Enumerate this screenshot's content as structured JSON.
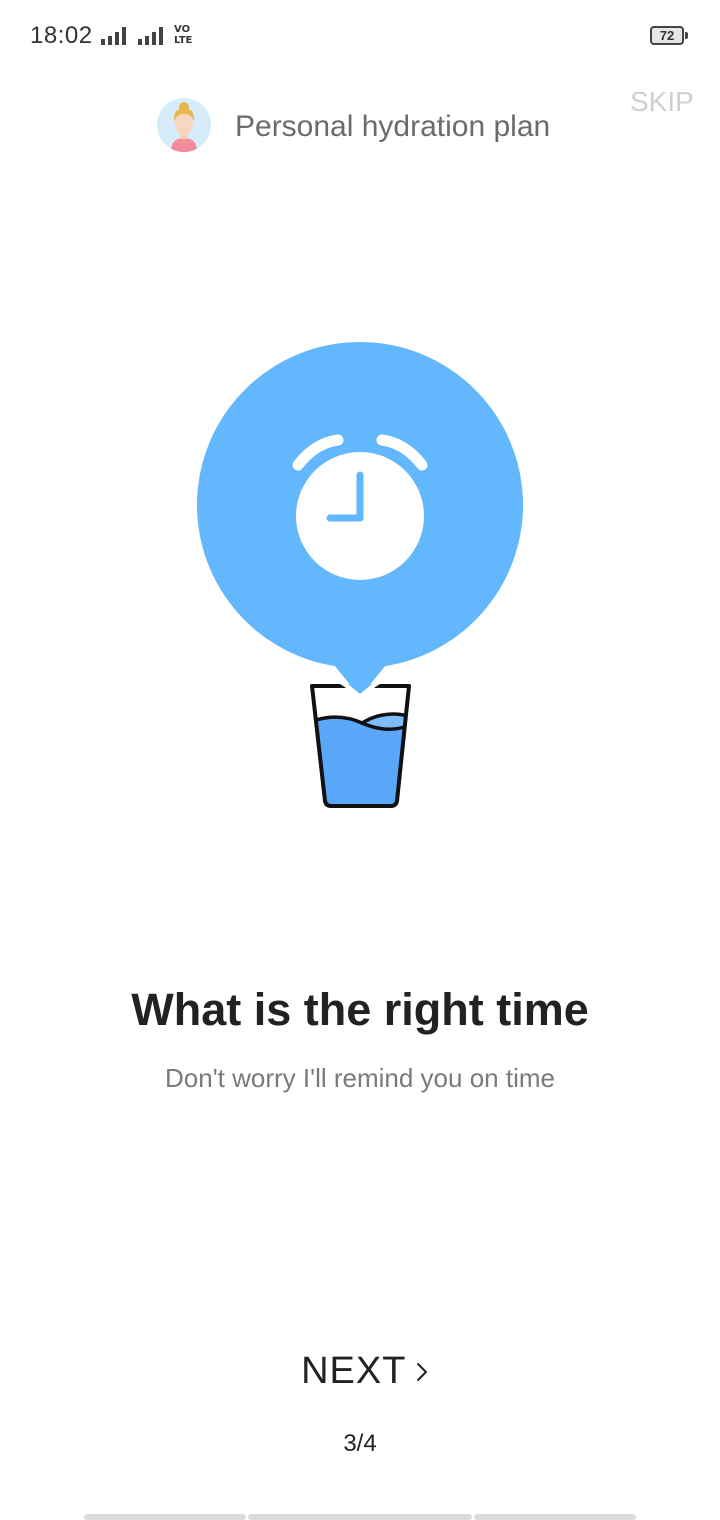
{
  "status_bar": {
    "time": "18:02",
    "network_label_top": "VO",
    "network_label_bottom": "LTE",
    "battery": "72"
  },
  "header": {
    "title": "Personal hydration plan",
    "skip_label": "SKIP"
  },
  "illustration": {
    "icons": [
      "alarm-clock-icon",
      "water-glass-icon"
    ],
    "colors": {
      "bubble": "#63b7fd",
      "water": "#5aa6f8",
      "clock_face": "#ffffff"
    }
  },
  "content": {
    "title": "What is the right time",
    "subtitle": "Don't worry I'll remind you on time"
  },
  "footer": {
    "next_label": "NEXT",
    "page_indicator": "3/4"
  }
}
